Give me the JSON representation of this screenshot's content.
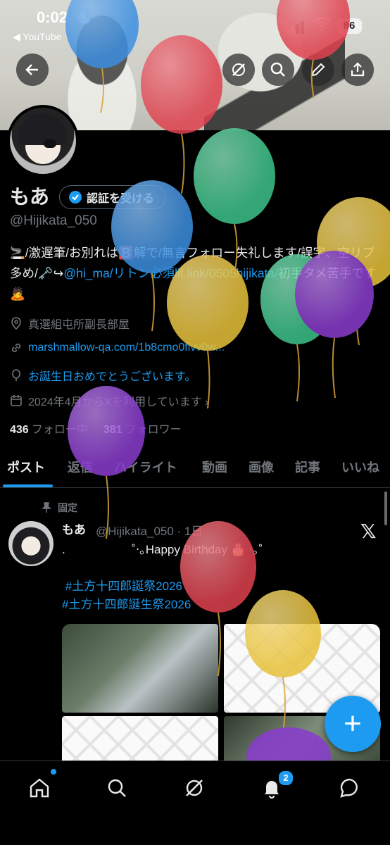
{
  "status_bar": {
    "time": "0:02",
    "back_app": "◀ YouTube",
    "battery": "86"
  },
  "header_buttons": [
    "back-arrow-icon",
    "grok-icon",
    "search-icon",
    "edit-icon",
    "share-icon"
  ],
  "profile": {
    "name": "もあ",
    "verify_label": "認証を受ける",
    "handle": "@Hijikata_050",
    "bio_parts": {
      "a": "🚬/激遅筆/お別れは🅱️解で/無言フォロー失礼します/誤字、空リプ多め/🗝️↪",
      "link1": "@hi_ma/リトン必須lit.link/",
      "link2": "0505hijikata/",
      "b": "初手タメ苦手です🙇"
    },
    "location": "真選組屯所副長部屋",
    "website": "marshmallow-qa.com/1b8cmo0flvv0w...",
    "birthday": "お誕生日おめでとうございます。",
    "joined": "2024年4月からXを利用しています ›",
    "following_count": "436",
    "following_label": "フォロー中",
    "followers_count": "381",
    "followers_label": "フォロワー"
  },
  "tabs": [
    "ポスト",
    "返信",
    "ハイライト",
    "動画",
    "画像",
    "記事",
    "いいね"
  ],
  "active_tab": "ポスト",
  "post": {
    "pinned_label": "固定",
    "author": "もあ",
    "meta": "@Hijikata_050 · 1日",
    "line1": ".                    ˚‧｡Happy Birthday 🎂 ‧｡˚",
    "tag1": "#土方十四郎誕祭2026",
    "tag2": "#土方十四郎誕生祭2026"
  },
  "fab_label": "+",
  "bottom_nav": {
    "items": [
      "home-icon",
      "search-icon",
      "grok-icon",
      "bell-icon",
      "chat-icon"
    ],
    "notification_count": "2"
  },
  "colors": {
    "accent": "#1d9bf0",
    "background": "#000000",
    "muted": "#71767b",
    "balloon_red": "#e0424f",
    "balloon_blue": "#3d8fe0",
    "balloon_green": "#3ec48a",
    "balloon_yellow": "#e8c23a",
    "balloon_purple": "#8a3ccf"
  }
}
